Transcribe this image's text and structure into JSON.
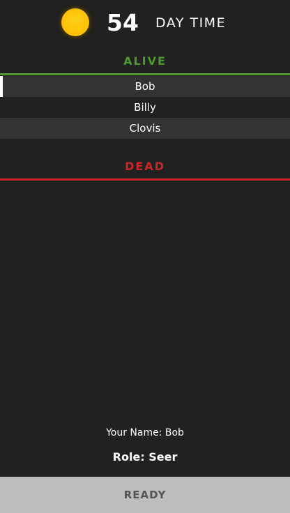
{
  "header": {
    "timer": "54",
    "phase": "DAY TIME",
    "phase_icon": "sun-icon",
    "sun_color": "#ffc107"
  },
  "alive": {
    "title": "ALIVE",
    "color": "#4e9a2f",
    "players": [
      "Bob",
      "Billy",
      "Clovis"
    ],
    "selected": "Bob"
  },
  "dead": {
    "title": "DEAD",
    "color": "#c62828",
    "players": []
  },
  "footer": {
    "your_name": "Your Name: Bob",
    "role": "Role: Seer",
    "ready_label": "READY"
  }
}
